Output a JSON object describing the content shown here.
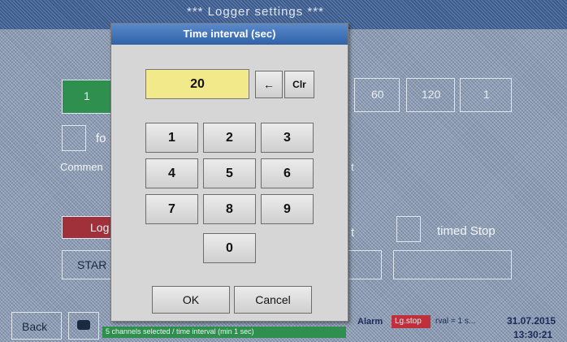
{
  "window": {
    "title": "*** Logger settings ***"
  },
  "background": {
    "interval_options": [
      "1",
      "60",
      "120",
      "1"
    ],
    "for_label": "fo",
    "comment_label": "Commen",
    "logger_button": "Log",
    "start_button": "STAR",
    "timed_stop_label": "timed Stop",
    "field_suffix": "t"
  },
  "dialog": {
    "title": "Time interval (sec)",
    "value": "20",
    "backspace_label": "←",
    "clear_label": "Clr",
    "keys": [
      "1",
      "2",
      "3",
      "4",
      "5",
      "6",
      "7",
      "8",
      "9",
      "0"
    ],
    "ok_label": "OK",
    "cancel_label": "Cancel"
  },
  "bottom_bar": {
    "back_label": "Back",
    "status_text": "5 channels selected / time interval (min 1 sec)",
    "alarm_label": "Alarm",
    "logging_label": "Lg.stop",
    "channel_text": "rval = 1 s...",
    "date": "31.07.2015",
    "time": "13:30:21"
  },
  "colors": {
    "dialog_title": "#2f62a8",
    "value_field": "#f2e98a",
    "status_green": "#2f8f4e",
    "alarm_red": "#c0303a"
  }
}
